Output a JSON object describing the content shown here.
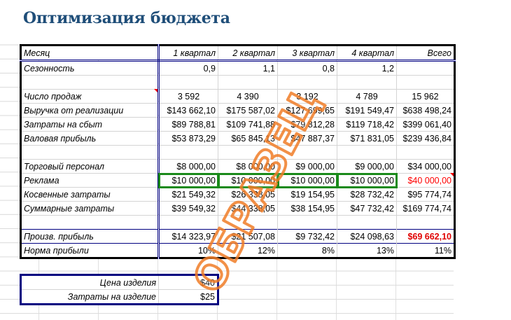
{
  "title": "Оптимизация бюджета",
  "watermark": "ОБРАЗЕЦ",
  "colors": {
    "title": "#1f4e79",
    "accent_border": "#000080",
    "highlight": "#1a8a1a",
    "negative": "#ff0000",
    "watermark": "#f07d28"
  },
  "header": [
    "Месяц",
    "1 квартал",
    "2 квартал",
    "3 квартал",
    "4 квартал",
    "Всего"
  ],
  "rows": {
    "season": [
      "Сезонность",
      "0,9",
      "1,1",
      "0,8",
      "1,2",
      ""
    ],
    "sales": [
      "Число продаж",
      "3 592",
      "4 390",
      "3 192",
      "4 789",
      "15 962"
    ],
    "revenue": [
      "Выручка от реализации",
      "$143 662,10",
      "$175 587,02",
      "$127 699,65",
      "$191 549,47",
      "$638 498,24"
    ],
    "cost": [
      "Затраты на сбыт",
      "$89 788,81",
      "$109 741,88",
      "$79 812,28",
      "$119 718,42",
      "$399 061,40"
    ],
    "gross": [
      "Валовая прибыль",
      "$53 873,29",
      "$65 845,13",
      "$47 887,37",
      "$71 831,05",
      "$239 436,84"
    ],
    "staff": [
      "Торговый персонал",
      "$8 000,00",
      "$8 000,00",
      "$9 000,00",
      "$9 000,00",
      "$34 000,00"
    ],
    "ads": [
      "Реклама",
      "$10 000,00",
      "$10 000,00",
      "$10 000,00",
      "$10 000,00",
      "$40 000,00"
    ],
    "overhead": [
      "Косвенные затраты",
      "$21 549,32",
      "$26 338,05",
      "$19 154,95",
      "$28 732,42",
      "$95 774,74"
    ],
    "total_cost": [
      "Суммарные затраты",
      "$39 549,32",
      "$44 338,05",
      "$38 154,95",
      "$47 732,42",
      "$169 774,74"
    ],
    "profit": [
      "Произв. прибыль",
      "$14 323,97",
      "$21 507,08",
      "$9 732,42",
      "$24 098,63",
      "$69 662,10"
    ],
    "margin": [
      "Норма прибыли",
      "10%",
      "12%",
      "8%",
      "13%",
      "11%"
    ]
  },
  "inputs": [
    {
      "label": "Цена изделия",
      "value": "$40"
    },
    {
      "label": "Затраты на изделие",
      "value": "$25"
    }
  ]
}
